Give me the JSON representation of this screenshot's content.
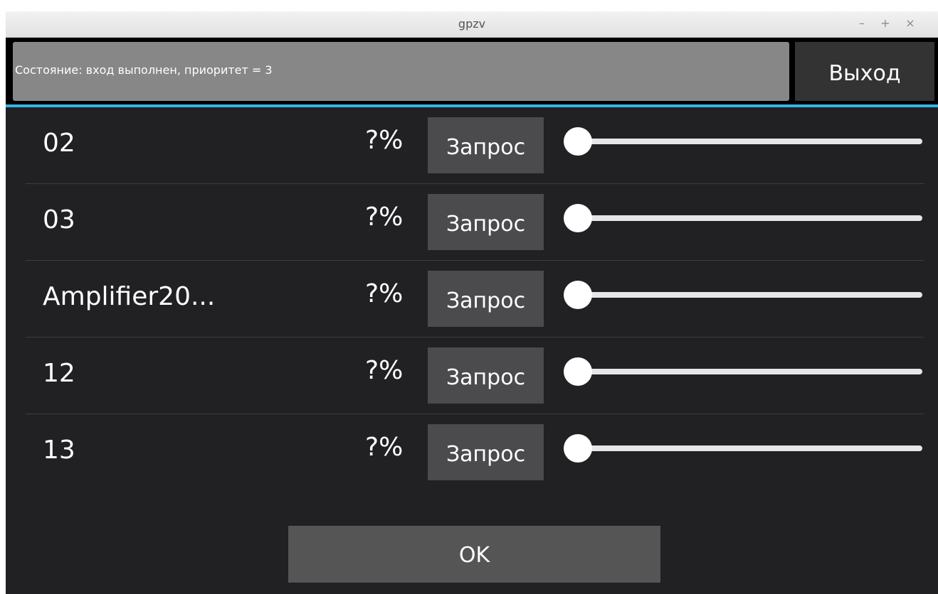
{
  "window": {
    "title": "gpzv",
    "minimize_glyph": "–",
    "maximize_glyph": "+",
    "close_glyph": "×"
  },
  "header": {
    "status_text": "Состояние: вход выполнен, приоритет = 3",
    "exit_label": "Выход"
  },
  "devices": [
    {
      "name": "02",
      "percent": "?%",
      "request_label": "Запрос",
      "slider_value": 0
    },
    {
      "name": "03",
      "percent": "?%",
      "request_label": "Запрос",
      "slider_value": 0
    },
    {
      "name": "Amplifier20...",
      "percent": "?%",
      "request_label": "Запрос",
      "slider_value": 0
    },
    {
      "name": "12",
      "percent": "?%",
      "request_label": "Запрос",
      "slider_value": 0
    },
    {
      "name": "13",
      "percent": "?%",
      "request_label": "Запрос",
      "slider_value": 0
    }
  ],
  "footer": {
    "ok_label": "OK"
  },
  "colors": {
    "accent": "#33b5e5",
    "background": "#212023",
    "button": "#4b4a4d"
  }
}
